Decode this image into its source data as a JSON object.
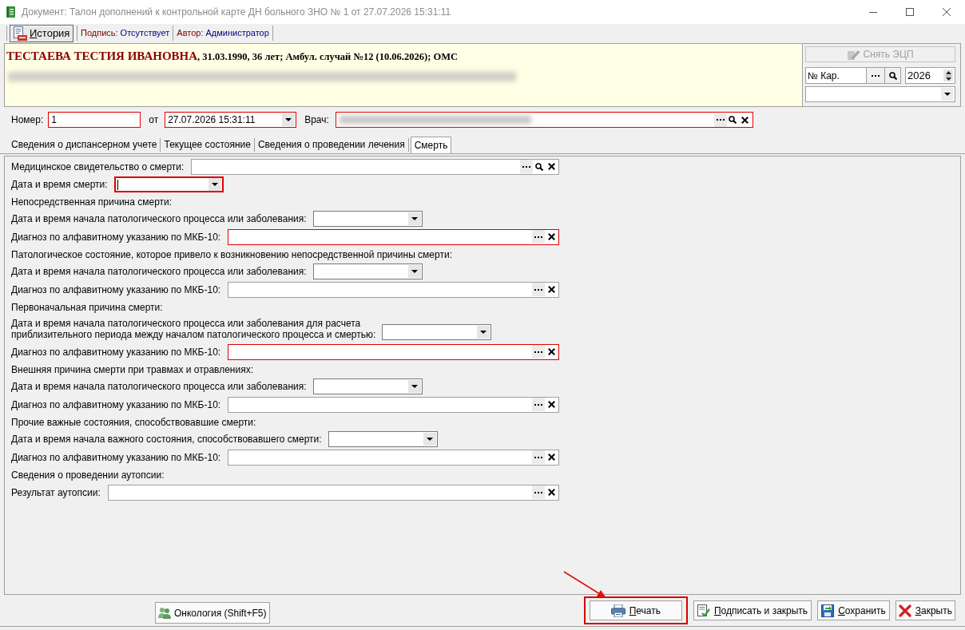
{
  "window": {
    "title": "Документ: Талон дополнений к контрольной карте ДН больного ЗНО № 1 от 27.07.2026 15:31:11"
  },
  "toolbar": {
    "history_button": {
      "label": "История",
      "pressed": true,
      "mnemonic": true
    },
    "info": [
      {
        "label": "Подпись:",
        "value": "Отсутствует"
      },
      {
        "label": "Автор:",
        "value": "Администратор"
      }
    ]
  },
  "patient": {
    "name": "ТЕСТАЕВА ТЕСТИЯ ИВАНОВНА",
    "details": ", 31.03.1990, 36 лет; Амбул. случай №12 (10.06.2026); ОМС",
    "address_blurred": true
  },
  "side_panel": {
    "unsign_button": {
      "label": "Снять ЭЦП",
      "disabled": true
    },
    "card_field": {
      "value": "№ Кар."
    },
    "year_field": {
      "value": "2026"
    }
  },
  "header_fields": [
    {
      "kind": "text",
      "label": "Номер:",
      "value": "1",
      "required": true
    },
    {
      "kind": "datetime",
      "label": "от",
      "value": "27.07.2026 15:31:11",
      "required": true
    },
    {
      "kind": "lookup",
      "label": "Врач:",
      "value_blurred": true,
      "search": true,
      "required": true
    }
  ],
  "tabs": [
    {
      "label": "Сведения о диспансерном учете",
      "selected": false
    },
    {
      "label": "Текущее состояние",
      "selected": false
    },
    {
      "label": "Сведения о проведении лечения",
      "selected": false
    },
    {
      "label": "Смерть",
      "selected": true
    }
  ],
  "form": {
    "rows": [
      {
        "kind": "lookup",
        "label": "Медицинское свидетельство о смерти:",
        "search": true,
        "required": false
      },
      {
        "kind": "date",
        "label": "Дата и время смерти:",
        "required": true,
        "focused": true
      },
      {
        "kind": "heading",
        "label": "Непосредственная причина смерти:"
      },
      {
        "kind": "date",
        "label": "Дата и время начала патологического процесса или заболевания:",
        "required": false,
        "focused": false
      },
      {
        "kind": "lookup",
        "label": "Диагноз по алфавитному указанию по МКБ-10:",
        "search": false,
        "required": true
      },
      {
        "kind": "heading",
        "label": "Патологическое состояние, которое привело к возникновению непосредственной причины смерти:"
      },
      {
        "kind": "date",
        "label": "Дата и время начала патологического процесса или заболевания:",
        "required": false,
        "focused": false
      },
      {
        "kind": "lookup",
        "label": "Диагноз по алфавитному указанию по МКБ-10:",
        "search": false,
        "required": false
      },
      {
        "kind": "heading",
        "label": "Первоначальная причина смерти:"
      },
      {
        "kind": "date",
        "label": "Дата и время начала патологического процесса или заболевания для расчета\nприблизительного периода между началом патологического процесса и смертью:",
        "required": false,
        "focused": false
      },
      {
        "kind": "lookup",
        "label": "Диагноз по алфавитному указанию по МКБ-10:",
        "search": false,
        "required": true
      },
      {
        "kind": "heading",
        "label": "Внешняя причина смерти при травмах и отравлениях:"
      },
      {
        "kind": "date",
        "label": "Дата и время начала патологического процесса или заболевания:",
        "required": false,
        "focused": false
      },
      {
        "kind": "lookup",
        "label": "Диагноз по алфавитному указанию по МКБ-10:",
        "search": false,
        "required": false
      },
      {
        "kind": "heading",
        "label": "Прочие важные состояния, способствовавшие смерти:"
      },
      {
        "kind": "date",
        "label": "Дата и время начала важного состояния, способствовавшего смерти:",
        "required": false,
        "focused": false
      },
      {
        "kind": "lookup",
        "label": "Диагноз по алфавитному указанию по МКБ-10:",
        "search": false,
        "required": false
      },
      {
        "kind": "heading",
        "label": "Сведения о проведении аутопсии:"
      },
      {
        "kind": "lookup",
        "label": "Результат аутопсии:",
        "search": false,
        "required": false
      }
    ]
  },
  "bottom_bar": {
    "oncology_button": {
      "label": "Онкология (Shift+F5)"
    },
    "buttons": [
      {
        "kind": "print",
        "label": "Печать",
        "mnemonic": true,
        "highlighted": true
      },
      {
        "kind": "sign",
        "label": "Подписать и закрыть",
        "mnemonic": true,
        "highlighted": false
      },
      {
        "kind": "save",
        "label": "Сохранить",
        "mnemonic": true,
        "highlighted": false
      },
      {
        "kind": "close",
        "label": "Закрыть",
        "mnemonic": true,
        "highlighted": false
      }
    ]
  }
}
